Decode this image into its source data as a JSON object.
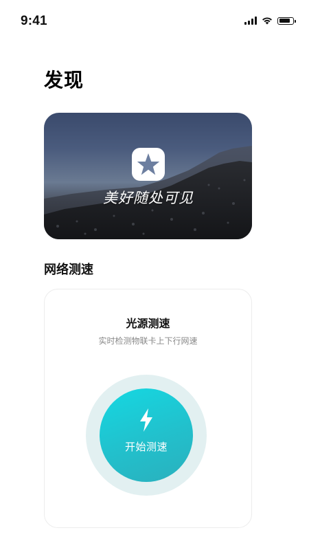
{
  "status_bar": {
    "time": "9:41",
    "icons": [
      "cellular-signal-icon",
      "wifi-icon",
      "battery-icon"
    ],
    "battery_level": 0.85
  },
  "page": {
    "title": "发现"
  },
  "banner": {
    "logo_icon": "star-logo-icon",
    "slogan": "美好随处可见"
  },
  "section": {
    "title": "网络测速"
  },
  "speed_test": {
    "title": "光源测速",
    "subtitle": "实时检测物联卡上下行网速",
    "button_icon": "lightning-bolt-icon",
    "button_label": "开始测速"
  },
  "colors": {
    "accent": "#1fc8d4",
    "ring": "#e2f0f1",
    "subtitle": "#888888"
  }
}
